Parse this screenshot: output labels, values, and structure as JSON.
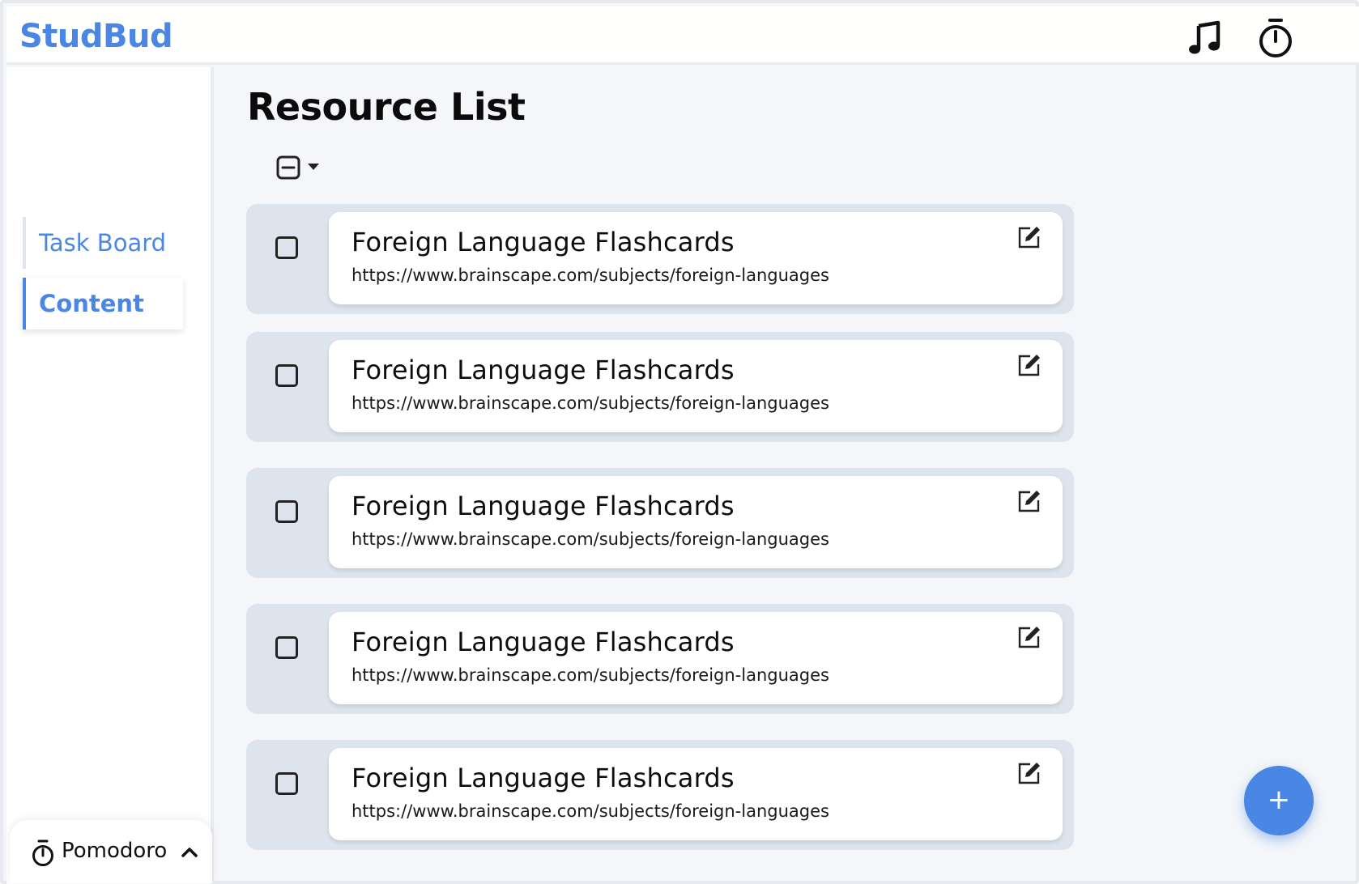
{
  "app": {
    "brand": "StudBud",
    "accent_color": "#4a86e3"
  },
  "header": {
    "icons": [
      "music-note-icon",
      "stopwatch-icon"
    ]
  },
  "sidebar": {
    "items": [
      {
        "label": "Task Board",
        "active": false
      },
      {
        "label": "Content",
        "active": true
      }
    ],
    "pomodoro": {
      "label": "Pomodoro",
      "icon": "stopwatch-icon",
      "chevron": "chevron-up-icon"
    }
  },
  "main": {
    "title": "Resource List",
    "resources": [
      {
        "title": "Foreign Language Flashcards",
        "url": "https://www.brainscape.com/subjects/foreign-languages"
      },
      {
        "title": "Foreign Language Flashcards",
        "url": "https://www.brainscape.com/subjects/foreign-languages"
      },
      {
        "title": "Foreign Language Flashcards",
        "url": "https://www.brainscape.com/subjects/foreign-languages"
      },
      {
        "title": "Foreign Language Flashcards",
        "url": "https://www.brainscape.com/subjects/foreign-languages"
      },
      {
        "title": "Foreign Language Flashcards",
        "url": "https://www.brainscape.com/subjects/foreign-languages"
      }
    ],
    "fab_label": "+"
  }
}
